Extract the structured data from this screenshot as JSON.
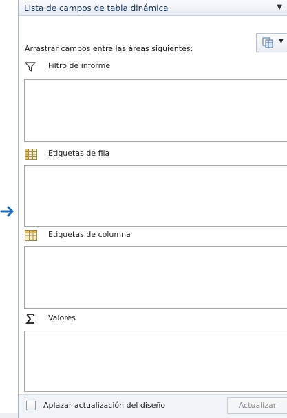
{
  "panel": {
    "title": "Lista de campos de tabla dinámica",
    "instructions": "Arrastrar campos entre las áreas siguientes:"
  },
  "icons": {
    "title_menu": "chevron-down-icon",
    "layout": "field-list-layout-icon",
    "filter": "filter-funnel-icon",
    "rows": "row-labels-grid-icon",
    "columns": "column-labels-grid-icon",
    "values": "sigma-icon",
    "pointer": "arrow-right-icon"
  },
  "areas": {
    "filter": {
      "label": "Filtro de informe"
    },
    "rows": {
      "label": "Etiquetas de fila"
    },
    "columns": {
      "label": "Etiquetas de columna"
    },
    "values": {
      "label": "Valores"
    }
  },
  "footer": {
    "defer_label": "Aplazar actualización del diseño",
    "defer_checked": false,
    "update_label": "Actualizar",
    "update_enabled": false
  },
  "colors": {
    "title_text": "#15315a",
    "pointer_arrow": "#1f6db0",
    "area_border": "#a6a6a6",
    "disabled_text": "#8a8a8a"
  }
}
